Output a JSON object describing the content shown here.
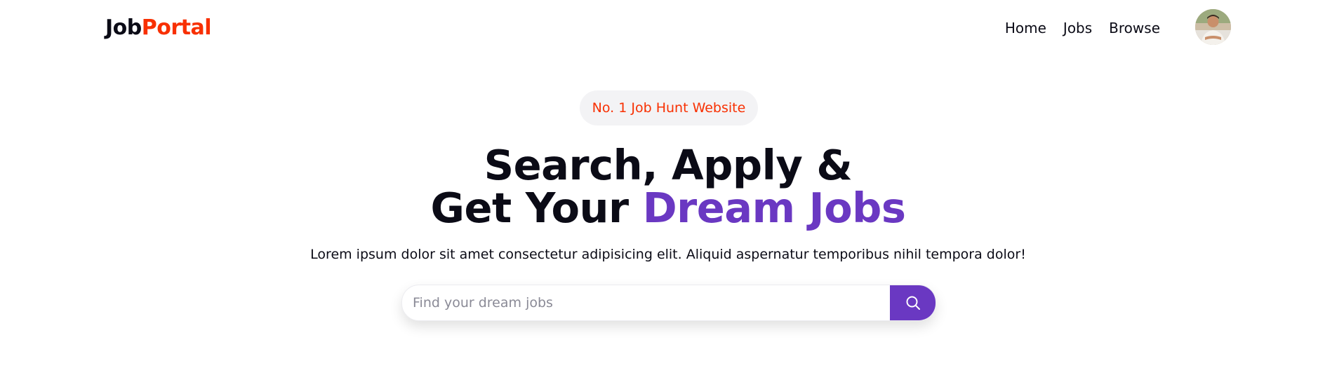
{
  "navbar": {
    "logo_part1": "Job",
    "logo_part2": "Portal",
    "links": [
      "Home",
      "Jobs",
      "Browse"
    ],
    "avatar_icon": "user-avatar-photo"
  },
  "hero": {
    "badge": "No. 1 Job Hunt Website",
    "headline_line1": "Search, Apply &",
    "headline_line2_prefix": "Get Your ",
    "headline_line2_accent": "Dream Jobs",
    "tagline": "Lorem ipsum dolor sit amet consectetur adipisicing elit. Aliquid aspernatur temporibus nihil tempora dolor!"
  },
  "search": {
    "placeholder": "Find your dream jobs",
    "value": "",
    "button_icon": "search-icon"
  },
  "colors": {
    "brand_red": "#f83002",
    "accent_purple": "#6a38c2",
    "text_dark": "#0b0b16",
    "badge_bg": "#f3f3f5"
  }
}
